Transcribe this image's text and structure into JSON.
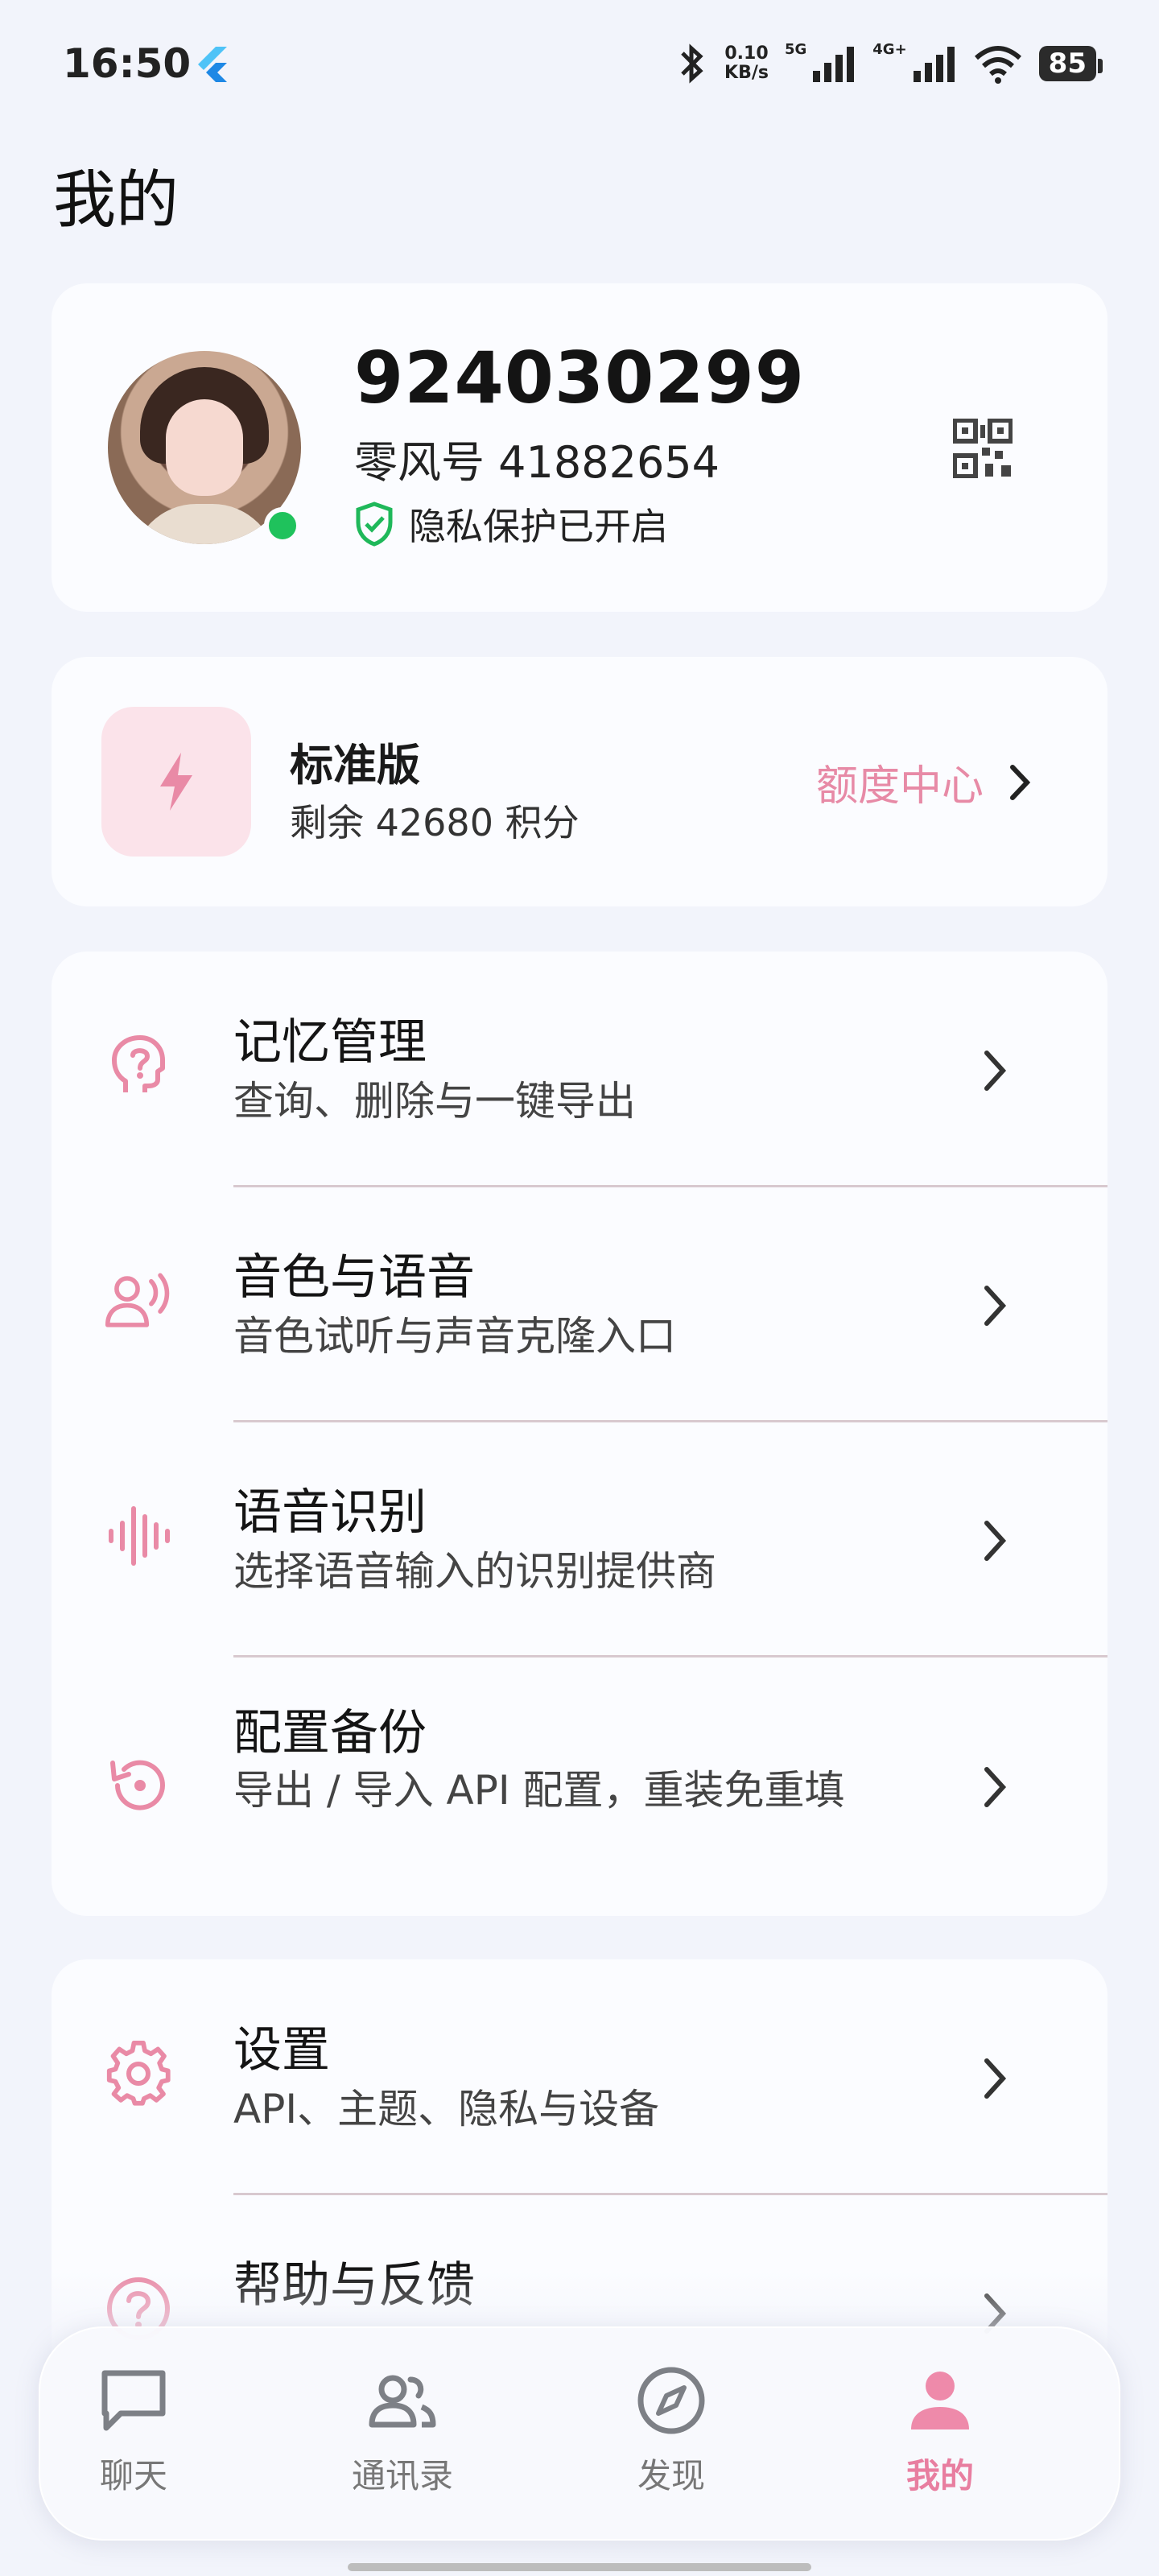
{
  "status_bar": {
    "time": "16:50",
    "net_speed_value": "0.10",
    "net_speed_unit": "KB/s",
    "sim1": "5G",
    "sim2": "4G+",
    "battery": "85"
  },
  "page": {
    "title": "我的"
  },
  "profile": {
    "username": "924030299",
    "lingfeng_id": "零风号 41882654",
    "privacy_status": "隐私保护已开启",
    "online_color": "#1fc25c"
  },
  "plan": {
    "name": "标准版",
    "points": "剩余 42680 积分",
    "quota_link": "额度中心",
    "accent": "#e78aa6"
  },
  "menu_group1": [
    {
      "title": "记忆管理",
      "subtitle": "查询、删除与一键导出",
      "icon": "brain-question-icon"
    },
    {
      "title": "音色与语音",
      "subtitle": "音色试听与声音克隆入口",
      "icon": "voice-person-icon"
    },
    {
      "title": "语音识别",
      "subtitle": "选择语音输入的识别提供商",
      "icon": "waveform-icon"
    },
    {
      "title": "配置备份",
      "subtitle": "导出 / 导入 API 配置，重装免重填",
      "icon": "backup-restore-icon"
    }
  ],
  "menu_group2": [
    {
      "title": "设置",
      "subtitle": "API、主题、隐私与设备",
      "icon": "gear-icon"
    },
    {
      "title": "帮助与反馈",
      "subtitle": "",
      "icon": "help-circle-icon"
    }
  ],
  "bottom_nav": [
    {
      "label": "聊天",
      "icon": "chat-icon",
      "active": false
    },
    {
      "label": "通讯录",
      "icon": "contacts-icon",
      "active": false
    },
    {
      "label": "发现",
      "icon": "compass-icon",
      "active": false
    },
    {
      "label": "我的",
      "icon": "person-icon",
      "active": true
    }
  ]
}
